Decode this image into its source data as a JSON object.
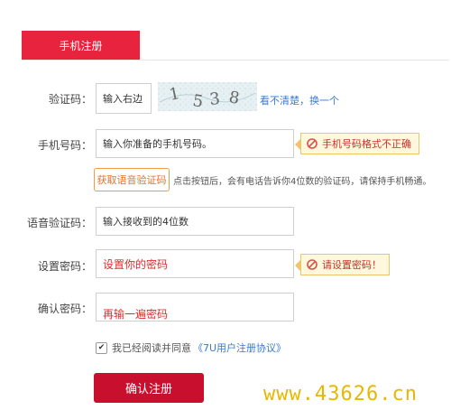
{
  "header": {
    "tab_label": "手机注册"
  },
  "captcha": {
    "label": "验证码：",
    "input_value": "输入右边",
    "image_text": "1538",
    "refresh_text": "看不清楚，换一个"
  },
  "phone": {
    "label": "手机号码：",
    "input_value": "输入你准备的手机号码。",
    "error": "手机号码格式不正确"
  },
  "voice": {
    "button_label": "获取语音验证码",
    "hint": "点击按钮后，会有电话告诉你4位数的验证码，请保持手机畅通。",
    "label": "语音验证码：",
    "input_value": "输入接收到的4位数"
  },
  "password": {
    "label": "设置密码：",
    "input_value": "设置你的密码",
    "error": "请设置密码！"
  },
  "confirm_password": {
    "label": "确认密码：",
    "input_value": "再输一遍密码"
  },
  "agreement": {
    "checked": true,
    "text": "我已经阅读并同意",
    "link_text": "《7U用户注册协议》"
  },
  "submit": {
    "label": "确认注册"
  },
  "watermark": {
    "text": "www.43626.cn"
  },
  "colors": {
    "accent": "#e8233d",
    "submit": "#c8102e",
    "error_text": "#c9302c",
    "error_bg": "#fff8dc",
    "link": "#3a7bd5",
    "voice_button": "#e8702a"
  }
}
